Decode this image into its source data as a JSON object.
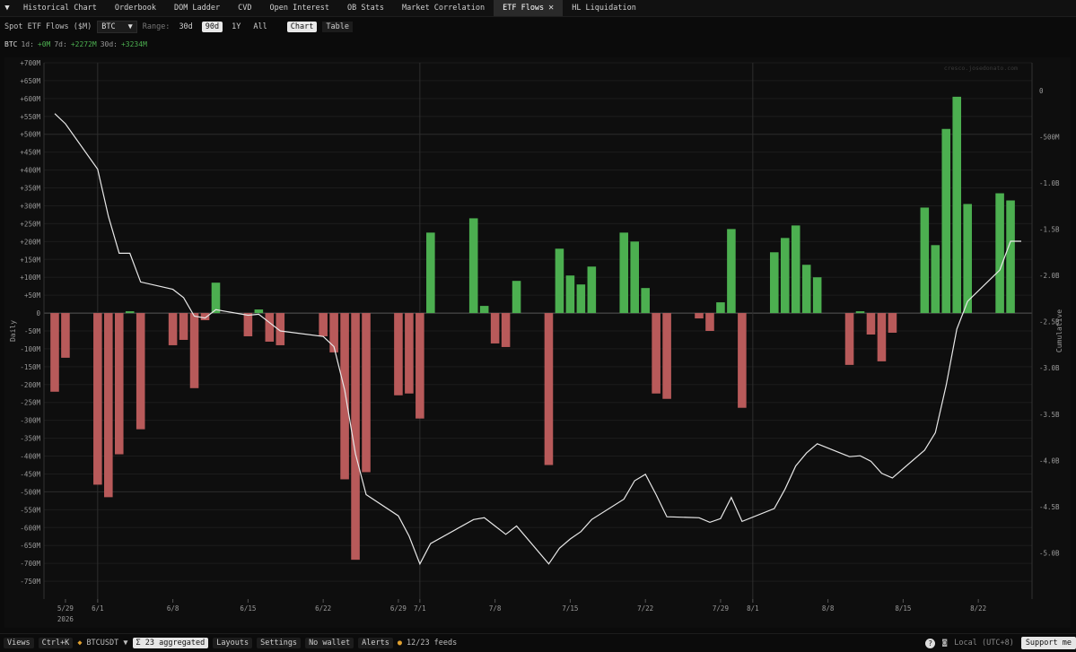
{
  "tabs": [
    {
      "label": "Historical Chart"
    },
    {
      "label": "Orderbook"
    },
    {
      "label": "DOM Ladder"
    },
    {
      "label": "CVD"
    },
    {
      "label": "Open Interest"
    },
    {
      "label": "OB Stats"
    },
    {
      "label": "Market Correlation"
    },
    {
      "label": "ETF Flows",
      "active": true
    },
    {
      "label": "HL Liquidation"
    }
  ],
  "controls": {
    "title": "Spot ETF Flows ($M)",
    "asset": "BTC",
    "range_label": "Range:",
    "ranges": [
      "30d",
      "90d",
      "1Y",
      "All"
    ],
    "range_selected": "90d",
    "views": [
      "Chart",
      "Table"
    ],
    "view_selected": "Chart"
  },
  "summary": {
    "asset": "BTC",
    "d1_label": "1d:",
    "d1": "+0M",
    "d7_label": "7d:",
    "d7": "+2272M",
    "d30_label": "30d:",
    "d30": "+3234M"
  },
  "watermark": "cresco.josedonato.com",
  "chart_data": {
    "type": "bar",
    "ylabel": "Daily",
    "y2label": "Cumulative",
    "ylim": [
      -800,
      700
    ],
    "y_ticks": [
      700,
      650,
      600,
      550,
      500,
      450,
      400,
      350,
      300,
      250,
      200,
      150,
      100,
      50,
      0,
      -50,
      -100,
      -150,
      -200,
      -250,
      -300,
      -350,
      -400,
      -450,
      -500,
      -550,
      -600,
      -650,
      -700,
      -750
    ],
    "y_tick_labels": [
      "+700M",
      "+650M",
      "+600M",
      "+550M",
      "+500M",
      "+450M",
      "+400M",
      "+350M",
      "+300M",
      "+250M",
      "+200M",
      "+150M",
      "+100M",
      "+50M",
      "0",
      "-50M",
      "-100M",
      "-150M",
      "-200M",
      "-250M",
      "-300M",
      "-350M",
      "-400M",
      "-450M",
      "-500M",
      "-550M",
      "-600M",
      "-650M",
      "-700M",
      "-750M"
    ],
    "y2lim": [
      -5.5,
      0.3
    ],
    "y2_ticks": [
      0,
      -0.5,
      -1.0,
      -1.5,
      -2.0,
      -2.5,
      -3.0,
      -3.5,
      -4.0,
      -4.5,
      -5.0
    ],
    "y2_tick_labels": [
      "0",
      "-500M",
      "-1.0B",
      "-1.5B",
      "-2.0B",
      "-2.5B",
      "-3.0B",
      "-3.5B",
      "-4.0B",
      "-4.5B",
      "-5.0B"
    ],
    "x_ticks": [
      {
        "x": "2026-05-29",
        "label": "5/29",
        "sub": "2026"
      },
      {
        "x": "2026-06-01",
        "label": "6/1"
      },
      {
        "x": "2026-06-08",
        "label": "6/8"
      },
      {
        "x": "2026-06-15",
        "label": "6/15"
      },
      {
        "x": "2026-06-22",
        "label": "6/22"
      },
      {
        "x": "2026-06-29",
        "label": "6/29"
      },
      {
        "x": "2026-07-01",
        "label": "7/1"
      },
      {
        "x": "2026-07-08",
        "label": "7/8"
      },
      {
        "x": "2026-07-15",
        "label": "7/15"
      },
      {
        "x": "2026-07-22",
        "label": "7/22"
      },
      {
        "x": "2026-07-29",
        "label": "7/29"
      },
      {
        "x": "2026-08-01",
        "label": "8/1"
      },
      {
        "x": "2026-08-08",
        "label": "8/8"
      },
      {
        "x": "2026-08-15",
        "label": "8/15"
      },
      {
        "x": "2026-08-22",
        "label": "8/22"
      }
    ],
    "bars": [
      {
        "x": "2026-05-28",
        "value": -220
      },
      {
        "x": "2026-05-29",
        "value": -125
      },
      {
        "x": "2026-06-01",
        "value": -480
      },
      {
        "x": "2026-06-02",
        "value": -515
      },
      {
        "x": "2026-06-03",
        "value": -395
      },
      {
        "x": "2026-06-04",
        "value": 5
      },
      {
        "x": "2026-06-05",
        "value": -325
      },
      {
        "x": "2026-06-08",
        "value": -90
      },
      {
        "x": "2026-06-09",
        "value": -75
      },
      {
        "x": "2026-06-10",
        "value": -210
      },
      {
        "x": "2026-06-11",
        "value": -20
      },
      {
        "x": "2026-06-12",
        "value": 85
      },
      {
        "x": "2026-06-15",
        "value": -65
      },
      {
        "x": "2026-06-16",
        "value": 10
      },
      {
        "x": "2026-06-17",
        "value": -80
      },
      {
        "x": "2026-06-18",
        "value": -90
      },
      {
        "x": "2026-06-22",
        "value": -65
      },
      {
        "x": "2026-06-23",
        "value": -110
      },
      {
        "x": "2026-06-24",
        "value": -465
      },
      {
        "x": "2026-06-25",
        "value": -690
      },
      {
        "x": "2026-06-26",
        "value": -445
      },
      {
        "x": "2026-06-29",
        "value": -230
      },
      {
        "x": "2026-06-30",
        "value": -225
      },
      {
        "x": "2026-07-01",
        "value": -295
      },
      {
        "x": "2026-07-02",
        "value": 225
      },
      {
        "x": "2026-07-06",
        "value": 265
      },
      {
        "x": "2026-07-07",
        "value": 20
      },
      {
        "x": "2026-07-08",
        "value": -85
      },
      {
        "x": "2026-07-09",
        "value": -95
      },
      {
        "x": "2026-07-10",
        "value": 90
      },
      {
        "x": "2026-07-13",
        "value": -425
      },
      {
        "x": "2026-07-14",
        "value": 180
      },
      {
        "x": "2026-07-15",
        "value": 105
      },
      {
        "x": "2026-07-16",
        "value": 80
      },
      {
        "x": "2026-07-17",
        "value": 130
      },
      {
        "x": "2026-07-20",
        "value": 225
      },
      {
        "x": "2026-07-21",
        "value": 200
      },
      {
        "x": "2026-07-22",
        "value": 70
      },
      {
        "x": "2026-07-23",
        "value": -225
      },
      {
        "x": "2026-07-24",
        "value": -240
      },
      {
        "x": "2026-07-27",
        "value": -15
      },
      {
        "x": "2026-07-28",
        "value": -50
      },
      {
        "x": "2026-07-29",
        "value": 30
      },
      {
        "x": "2026-07-30",
        "value": 235
      },
      {
        "x": "2026-07-31",
        "value": -265
      },
      {
        "x": "2026-08-03",
        "value": 170
      },
      {
        "x": "2026-08-04",
        "value": 210
      },
      {
        "x": "2026-08-05",
        "value": 245
      },
      {
        "x": "2026-08-06",
        "value": 135
      },
      {
        "x": "2026-08-07",
        "value": 100
      },
      {
        "x": "2026-08-10",
        "value": -145
      },
      {
        "x": "2026-08-11",
        "value": 5
      },
      {
        "x": "2026-08-12",
        "value": -60
      },
      {
        "x": "2026-08-13",
        "value": -135
      },
      {
        "x": "2026-08-14",
        "value": -55
      },
      {
        "x": "2026-08-17",
        "value": 295
      },
      {
        "x": "2026-08-18",
        "value": 190
      },
      {
        "x": "2026-08-19",
        "value": 515
      },
      {
        "x": "2026-08-20",
        "value": 605
      },
      {
        "x": "2026-08-21",
        "value": 305
      },
      {
        "x": "2026-08-24",
        "value": 335
      },
      {
        "x": "2026-08-25",
        "value": 315
      }
    ],
    "cumulative": [
      {
        "x": "2026-05-28",
        "value": -0.25
      },
      {
        "x": "2026-05-29",
        "value": -0.36
      },
      {
        "x": "2026-06-01",
        "value": -0.85
      },
      {
        "x": "2026-06-02",
        "value": -1.36
      },
      {
        "x": "2026-06-03",
        "value": -1.76
      },
      {
        "x": "2026-06-04",
        "value": -1.76
      },
      {
        "x": "2026-06-05",
        "value": -2.07
      },
      {
        "x": "2026-06-08",
        "value": -2.15
      },
      {
        "x": "2026-06-09",
        "value": -2.24
      },
      {
        "x": "2026-06-10",
        "value": -2.44
      },
      {
        "x": "2026-06-11",
        "value": -2.46
      },
      {
        "x": "2026-06-12",
        "value": -2.37
      },
      {
        "x": "2026-06-15",
        "value": -2.43
      },
      {
        "x": "2026-06-16",
        "value": -2.42
      },
      {
        "x": "2026-06-17",
        "value": -2.51
      },
      {
        "x": "2026-06-18",
        "value": -2.6
      },
      {
        "x": "2026-06-22",
        "value": -2.66
      },
      {
        "x": "2026-06-23",
        "value": -2.77
      },
      {
        "x": "2026-06-24",
        "value": -3.24
      },
      {
        "x": "2026-06-25",
        "value": -3.93
      },
      {
        "x": "2026-06-26",
        "value": -4.37
      },
      {
        "x": "2026-06-29",
        "value": -4.6
      },
      {
        "x": "2026-06-30",
        "value": -4.82
      },
      {
        "x": "2026-07-01",
        "value": -5.12
      },
      {
        "x": "2026-07-02",
        "value": -4.9
      },
      {
        "x": "2026-07-06",
        "value": -4.64
      },
      {
        "x": "2026-07-07",
        "value": -4.62
      },
      {
        "x": "2026-07-08",
        "value": -4.71
      },
      {
        "x": "2026-07-09",
        "value": -4.8
      },
      {
        "x": "2026-07-10",
        "value": -4.71
      },
      {
        "x": "2026-07-13",
        "value": -5.12
      },
      {
        "x": "2026-07-14",
        "value": -4.95
      },
      {
        "x": "2026-07-15",
        "value": -4.85
      },
      {
        "x": "2026-07-16",
        "value": -4.77
      },
      {
        "x": "2026-07-17",
        "value": -4.64
      },
      {
        "x": "2026-07-20",
        "value": -4.42
      },
      {
        "x": "2026-07-21",
        "value": -4.22
      },
      {
        "x": "2026-07-22",
        "value": -4.15
      },
      {
        "x": "2026-07-23",
        "value": -4.37
      },
      {
        "x": "2026-07-24",
        "value": -4.61
      },
      {
        "x": "2026-07-27",
        "value": -4.62
      },
      {
        "x": "2026-07-28",
        "value": -4.67
      },
      {
        "x": "2026-07-29",
        "value": -4.63
      },
      {
        "x": "2026-07-30",
        "value": -4.4
      },
      {
        "x": "2026-07-31",
        "value": -4.66
      },
      {
        "x": "2026-08-03",
        "value": -4.52
      },
      {
        "x": "2026-08-04",
        "value": -4.31
      },
      {
        "x": "2026-08-05",
        "value": -4.06
      },
      {
        "x": "2026-08-06",
        "value": -3.92
      },
      {
        "x": "2026-08-07",
        "value": -3.82
      },
      {
        "x": "2026-08-10",
        "value": -3.96
      },
      {
        "x": "2026-08-11",
        "value": -3.95
      },
      {
        "x": "2026-08-12",
        "value": -4.01
      },
      {
        "x": "2026-08-13",
        "value": -4.14
      },
      {
        "x": "2026-08-14",
        "value": -4.19
      },
      {
        "x": "2026-08-17",
        "value": -3.89
      },
      {
        "x": "2026-08-18",
        "value": -3.7
      },
      {
        "x": "2026-08-19",
        "value": -3.19
      },
      {
        "x": "2026-08-20",
        "value": -2.58
      },
      {
        "x": "2026-08-21",
        "value": -2.28
      },
      {
        "x": "2026-08-24",
        "value": -1.94
      },
      {
        "x": "2026-08-25",
        "value": -1.63
      },
      {
        "x": "2026-08-26",
        "value": -1.63
      }
    ],
    "x_start": "2026-05-27",
    "x_end": "2026-08-27",
    "grid": true,
    "colors": {
      "positive": "#4caf50",
      "negative": "#b85a5a",
      "line": "#e8e8e8",
      "grid": "#1c1c1c",
      "zero": "#555555",
      "bg": "#0e0e0e"
    }
  },
  "bottom": {
    "views": "Views",
    "shortcut": "Ctrl+K",
    "symbol": "BTCUSDT",
    "aggregated": "Σ 23 aggregated",
    "layouts": "Layouts",
    "settings": "Settings",
    "wallet": "No wallet",
    "alerts": "Alerts",
    "feeds": "12/23 feeds",
    "timezone": "Local (UTC+8)",
    "support": "Support me",
    "help": "?"
  }
}
